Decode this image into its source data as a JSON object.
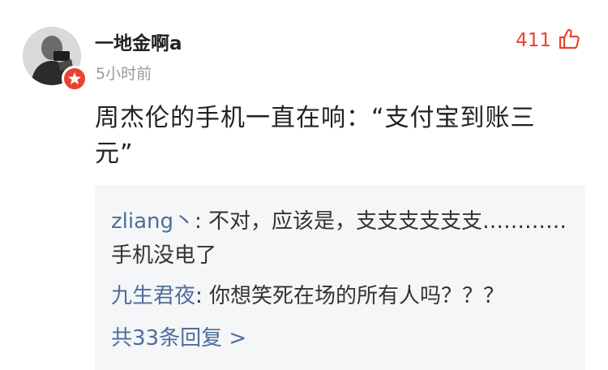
{
  "comment": {
    "username": "一地金啊a",
    "timestamp": "5小时前",
    "likes": "411",
    "text": "周杰伦的手机一直在响：“支付宝到账三元”"
  },
  "replies": [
    {
      "author": "zliang丶",
      "colon": ":",
      "text": "不对，应该是，支支支支支支…………手机没电了"
    },
    {
      "author": "九生君夜",
      "colon": ":",
      "text": "你想笑死在场的所有人吗？？？"
    }
  ],
  "view_all": "共33条回复 >",
  "icons": {
    "avatar": "user-avatar-photo",
    "badge": "vip-star-badge-icon",
    "like": "thumbs-up-icon"
  },
  "colors": {
    "accent_red": "#e8432f",
    "link_blue": "#4e6d9a",
    "timestamp_gray": "#9a9a9a",
    "reply_background": "#f5f6f8"
  }
}
